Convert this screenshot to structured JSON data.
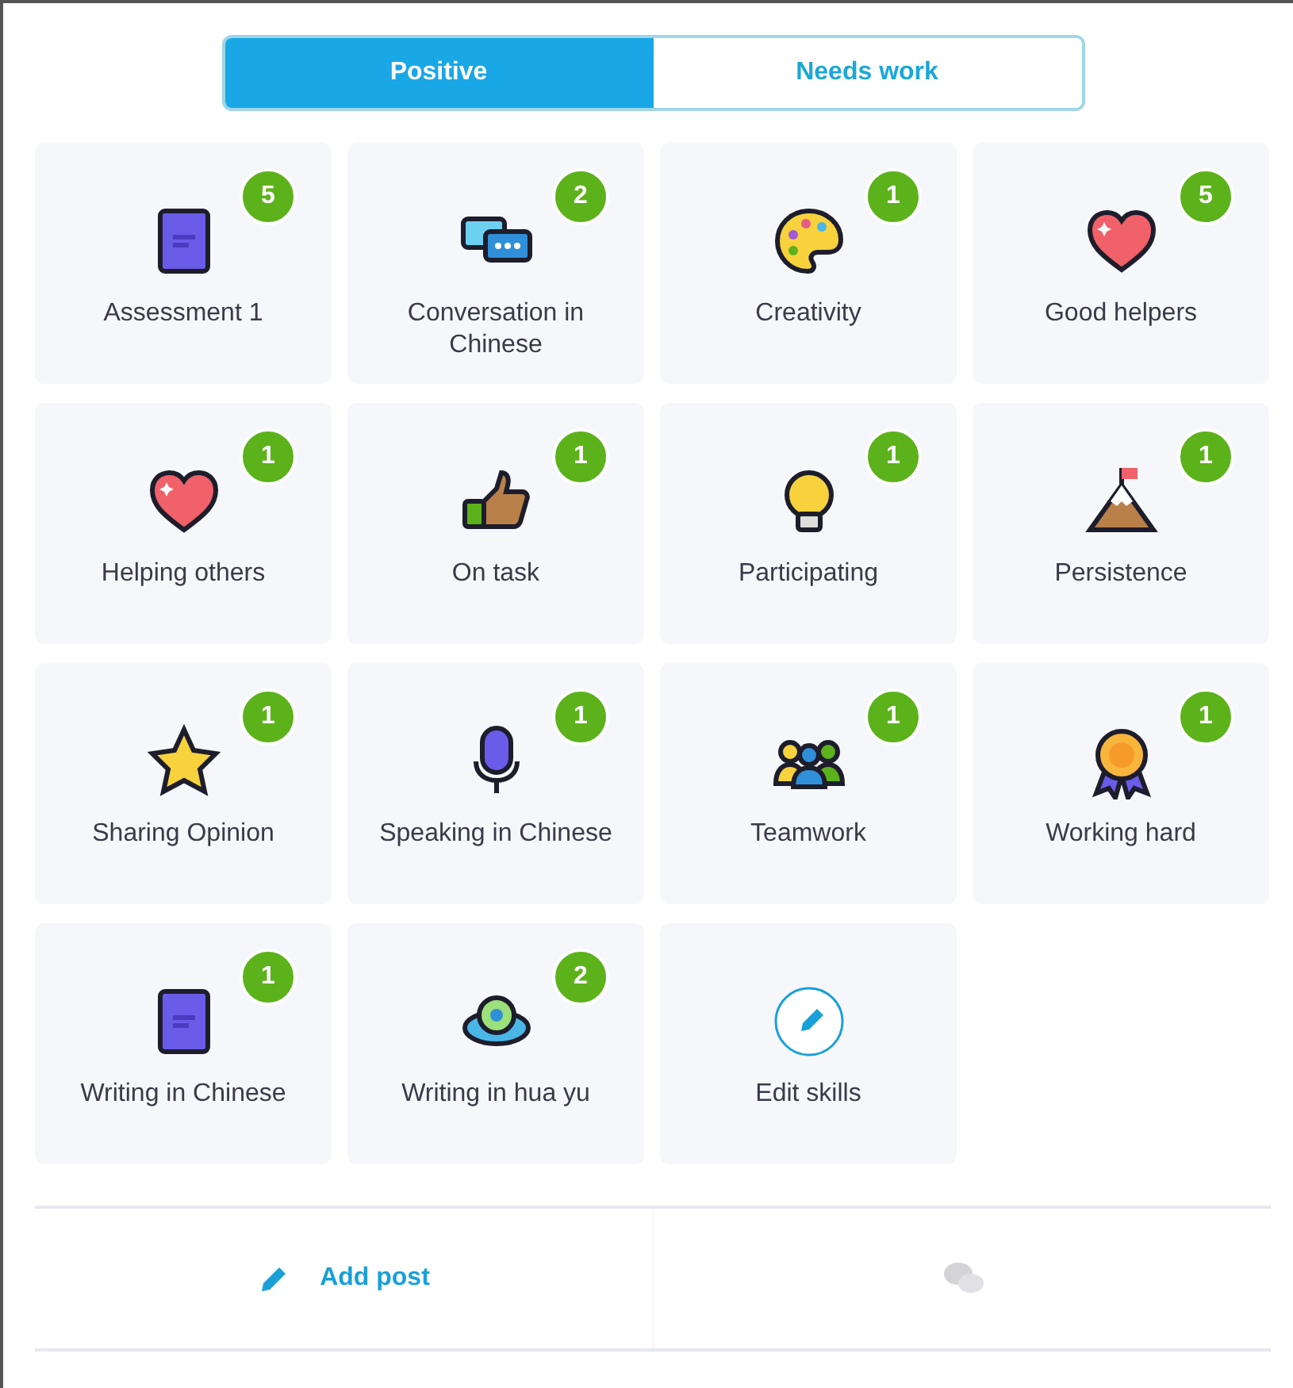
{
  "tabs": [
    {
      "label": "Positive",
      "selected": true
    },
    {
      "label": "Needs work",
      "selected": false
    }
  ],
  "skills": [
    {
      "kind": "skill",
      "label": "Assessment 1",
      "count": "5"
    },
    {
      "kind": "skill",
      "label": "Conversation in Chinese",
      "count": "2"
    },
    {
      "kind": "skill",
      "label": "Creativity",
      "count": "1"
    },
    {
      "kind": "skill",
      "label": "Good helpers",
      "count": "5"
    },
    {
      "kind": "skill",
      "label": "Helping others",
      "count": "1"
    },
    {
      "kind": "skill",
      "label": "On task",
      "count": "1"
    },
    {
      "kind": "skill",
      "label": "Participating",
      "count": "1"
    },
    {
      "kind": "skill",
      "label": "Persistence",
      "count": "1"
    },
    {
      "kind": "skill",
      "label": "Sharing Opinion",
      "count": "1"
    },
    {
      "kind": "skill",
      "label": "Speaking in Chinese",
      "count": "1"
    },
    {
      "kind": "skill",
      "label": "Teamwork",
      "count": "1"
    },
    {
      "kind": "skill",
      "label": "Working hard",
      "count": "1"
    },
    {
      "kind": "skill",
      "label": "Writing in Chinese",
      "count": "1"
    },
    {
      "kind": "skill",
      "label": "Writing in hua yu",
      "count": "2"
    },
    {
      "kind": "edit",
      "label": "Edit skills"
    }
  ],
  "actions": [
    {
      "label": "Add post",
      "disabled": false
    },
    {
      "disabled": true
    }
  ]
}
